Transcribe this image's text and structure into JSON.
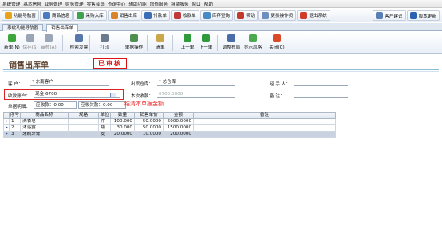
{
  "menu": [
    "系统管理",
    "基本信息",
    "业务处理",
    "财务管理",
    "零售会员",
    "查询中心",
    "辅助功能",
    "增值服务",
    "租赁服务",
    "窗口",
    "帮助"
  ],
  "quickbar": {
    "left": [
      {
        "label": "功能导航窗",
        "color": "#e8a317"
      },
      {
        "label": "商品信息",
        "color": "#4a7cc4"
      },
      {
        "label": "采购入库",
        "color": "#3fa34d"
      },
      {
        "label": "销售出库",
        "color": "#d8842a"
      },
      {
        "label": "付款单",
        "color": "#3a6fb7"
      },
      {
        "label": "收款单",
        "color": "#c03a3a"
      },
      {
        "label": "库存查询",
        "color": "#4a8ac4"
      },
      {
        "label": "帮助",
        "color": "#c0392b"
      },
      {
        "label": "更换操作员",
        "color": "#6f8fbf"
      },
      {
        "label": "退出系统",
        "color": "#d23b2a"
      }
    ],
    "right": [
      {
        "label": "客户建议",
        "color": "#5a7fb5"
      },
      {
        "label": "版本更新",
        "color": "#2b63b4"
      }
    ]
  },
  "tabs": [
    "系统功能导航器",
    "销售出库单"
  ],
  "toolbar": [
    {
      "label": "新单(N)",
      "color": "#3ca63c",
      "enabled": true
    },
    {
      "label": "保存(S)",
      "color": "#9aa6b5",
      "enabled": false
    },
    {
      "label": "审核(A)",
      "color": "#9aa6b5",
      "enabled": false
    },
    {
      "label": "检索发票",
      "color": "#5577aa",
      "enabled": true
    },
    {
      "label": "打印",
      "color": "#6b7a8f",
      "enabled": true
    },
    {
      "label": "单据操作",
      "color": "#4f8f4f",
      "enabled": true
    },
    {
      "label": "清单",
      "color": "#caa84a",
      "enabled": true
    },
    {
      "label": "上一单",
      "color": "#2f9a3b",
      "enabled": true
    },
    {
      "label": "下一单",
      "color": "#2f9a3b",
      "enabled": true
    },
    {
      "label": "调整布局",
      "color": "#4a6da8",
      "enabled": true
    },
    {
      "label": "显示风格",
      "color": "#4aa84f",
      "enabled": true
    },
    {
      "label": "关闭(C)",
      "color": "#d84a2a",
      "enabled": true
    }
  ],
  "doc": {
    "title": "销售出库单",
    "stamp": "已审核",
    "customer_label": "客  户：",
    "customer_value": "* 东南客户",
    "warehouse_label": "出货仓库：",
    "warehouse_value": "* 总仓库",
    "handler_label": "经 手 人：",
    "handler_value": "",
    "account_label": "收款账户：",
    "account_value": "现金 6700",
    "received_label": "本次收款：",
    "received_value": "6700.0000",
    "remark_label": "备  注：",
    "remark_value": "",
    "discount_label": "单据明细：",
    "discount_value": "应收款：0.00",
    "extra_label": "应收欠款：0.00",
    "annotation": "结清本单据金额"
  },
  "grid": {
    "headers": [
      "序号",
      "商品名称",
      "规格",
      "单位",
      "数量",
      "销售单价",
      "金额",
      "备注"
    ],
    "rows": [
      {
        "no": "1",
        "name": "洗衣皂",
        "spec": "",
        "unit": "件",
        "qty": "100.000",
        "price": "50.0000",
        "amount": "5000.0000",
        "note": ""
      },
      {
        "no": "2",
        "name": "沐浴露",
        "spec": "",
        "unit": "瓶",
        "qty": "30.000",
        "price": "50.0000",
        "amount": "1500.0000",
        "note": ""
      },
      {
        "no": "3",
        "name": "牙刷牙膏",
        "spec": "",
        "unit": "支",
        "qty": "20.0000",
        "price": "10.0000",
        "amount": "200.0000",
        "note": ""
      }
    ]
  }
}
